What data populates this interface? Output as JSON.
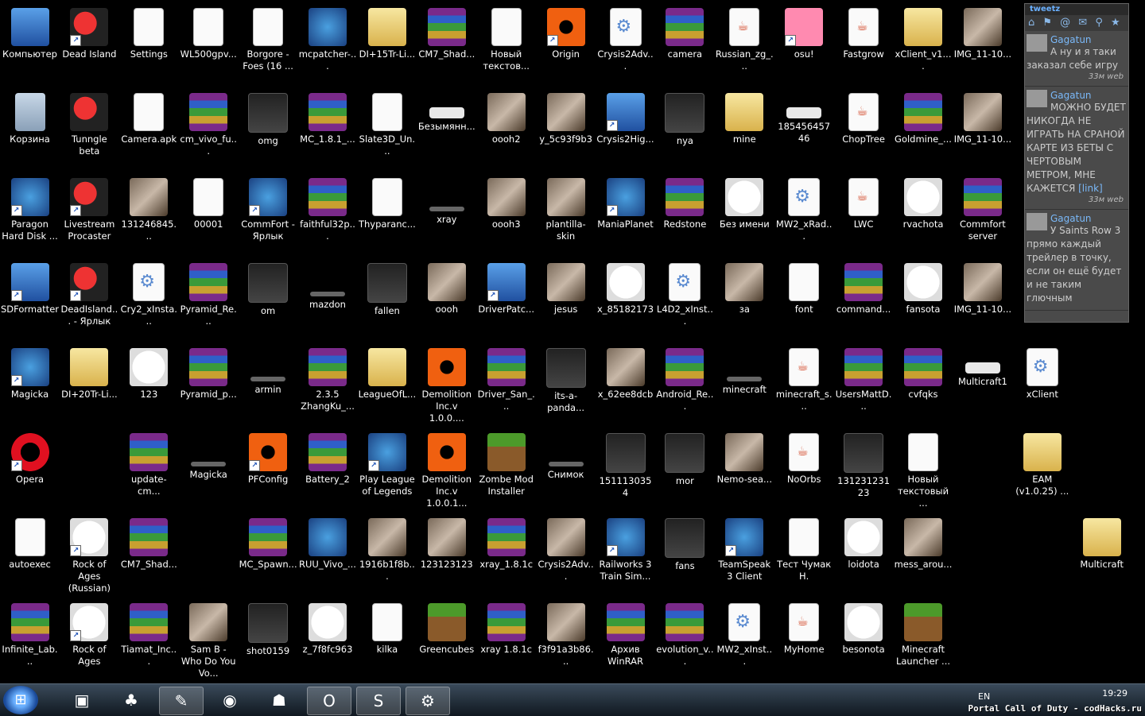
{
  "icons": [
    {
      "label": "Компьютер",
      "type": "pc",
      "col": 0,
      "row": 0,
      "shortcut": false
    },
    {
      "label": "Dead Island",
      "type": "shield",
      "col": 1,
      "row": 0,
      "shortcut": true
    },
    {
      "label": "Settings",
      "type": "doc",
      "col": 2,
      "row": 0,
      "shortcut": false
    },
    {
      "label": "WL500gpv...",
      "type": "doc",
      "col": 3,
      "row": 0,
      "shortcut": false
    },
    {
      "label": "Borgore - Foes (16 ...",
      "type": "doc",
      "col": 4,
      "row": 0,
      "shortcut": false
    },
    {
      "label": "mcpatcher-...",
      "type": "app",
      "col": 5,
      "row": 0,
      "shortcut": false
    },
    {
      "label": "DI+15Tr-Li...",
      "type": "folder",
      "col": 6,
      "row": 0,
      "shortcut": false
    },
    {
      "label": "CM7_Shad...",
      "type": "winrar",
      "col": 7,
      "row": 0,
      "shortcut": false
    },
    {
      "label": "Новый текстов...",
      "type": "doc",
      "col": 8,
      "row": 0,
      "shortcut": false
    },
    {
      "label": "Origin",
      "type": "orange",
      "col": 9,
      "row": 0,
      "shortcut": true
    },
    {
      "label": "Crysis2Adv...",
      "type": "gear",
      "col": 10,
      "row": 0,
      "shortcut": false
    },
    {
      "label": "camera",
      "type": "winrar",
      "col": 11,
      "row": 0,
      "shortcut": false
    },
    {
      "label": "Russian_zg_...",
      "type": "java",
      "col": 12,
      "row": 0,
      "shortcut": false
    },
    {
      "label": "osu!",
      "type": "pink",
      "col": 13,
      "row": 0,
      "shortcut": true
    },
    {
      "label": "Fastgrow",
      "type": "java",
      "col": 14,
      "row": 0,
      "shortcut": false
    },
    {
      "label": "xClient_v1....",
      "type": "folder",
      "col": 15,
      "row": 0,
      "shortcut": false
    },
    {
      "label": "IMG_11-10...",
      "type": "img",
      "col": 16,
      "row": 0,
      "shortcut": false
    },
    {
      "label": "Корзина",
      "type": "bin",
      "col": 0,
      "row": 1,
      "shortcut": false
    },
    {
      "label": "Tunngle beta",
      "type": "shield",
      "col": 1,
      "row": 1,
      "shortcut": false
    },
    {
      "label": "Camera.apk",
      "type": "doc",
      "col": 2,
      "row": 1,
      "shortcut": false
    },
    {
      "label": "cm_vivo_fu...",
      "type": "winrar",
      "col": 3,
      "row": 1,
      "shortcut": false
    },
    {
      "label": "omg",
      "type": "dark",
      "col": 4,
      "row": 1,
      "shortcut": false
    },
    {
      "label": "MC_1.8.1_...",
      "type": "winrar",
      "col": 5,
      "row": 1,
      "shortcut": false
    },
    {
      "label": "Slate3D_Un...",
      "type": "doc",
      "col": 6,
      "row": 1,
      "shortcut": false
    },
    {
      "label": "Безымянн...",
      "type": "wide",
      "col": 7,
      "row": 1,
      "shortcut": false
    },
    {
      "label": "oooh2",
      "type": "img",
      "col": 8,
      "row": 1,
      "shortcut": false
    },
    {
      "label": "y_5c93f9b3",
      "type": "img",
      "col": 9,
      "row": 1,
      "shortcut": false
    },
    {
      "label": "Crysis2Hig...",
      "type": "pc",
      "col": 10,
      "row": 1,
      "shortcut": true
    },
    {
      "label": "nya",
      "type": "dark",
      "col": 11,
      "row": 1,
      "shortcut": false
    },
    {
      "label": "mine",
      "type": "folder",
      "col": 12,
      "row": 1,
      "shortcut": false
    },
    {
      "label": "18545645746",
      "type": "wide",
      "col": 13,
      "row": 1,
      "shortcut": false
    },
    {
      "label": "ChopTree",
      "type": "java",
      "col": 14,
      "row": 1,
      "shortcut": false
    },
    {
      "label": "Goldmine_...",
      "type": "winrar",
      "col": 15,
      "row": 1,
      "shortcut": false
    },
    {
      "label": "IMG_11-10...",
      "type": "img",
      "col": 16,
      "row": 1,
      "shortcut": false
    },
    {
      "label": "Paragon Hard Disk ...",
      "type": "app",
      "col": 0,
      "row": 2,
      "shortcut": true
    },
    {
      "label": "Livestream Procaster",
      "type": "shield",
      "col": 1,
      "row": 2,
      "shortcut": true
    },
    {
      "label": "131246845...",
      "type": "img",
      "col": 2,
      "row": 2,
      "shortcut": false
    },
    {
      "label": "00001",
      "type": "doc",
      "col": 3,
      "row": 2,
      "shortcut": false
    },
    {
      "label": "CommFort - Ярлык",
      "type": "app",
      "col": 4,
      "row": 2,
      "shortcut": true
    },
    {
      "label": "faithful32p...",
      "type": "winrar",
      "col": 5,
      "row": 2,
      "shortcut": false
    },
    {
      "label": "Thyparanc...",
      "type": "doc",
      "col": 6,
      "row": 2,
      "shortcut": false
    },
    {
      "label": "xray",
      "type": "thin",
      "col": 7,
      "row": 2,
      "shortcut": false
    },
    {
      "label": "oooh3",
      "type": "img",
      "col": 8,
      "row": 2,
      "shortcut": false
    },
    {
      "label": "plantilla-skin",
      "type": "img",
      "col": 9,
      "row": 2,
      "shortcut": false
    },
    {
      "label": "ManiaPlanet",
      "type": "app",
      "col": 10,
      "row": 2,
      "shortcut": true
    },
    {
      "label": "Redstone",
      "type": "winrar",
      "col": 11,
      "row": 2,
      "shortcut": false
    },
    {
      "label": "Без имени",
      "type": "face",
      "col": 12,
      "row": 2,
      "shortcut": false
    },
    {
      "label": "MW2_xRad...",
      "type": "gear",
      "col": 13,
      "row": 2,
      "shortcut": false
    },
    {
      "label": "LWC",
      "type": "java",
      "col": 14,
      "row": 2,
      "shortcut": false
    },
    {
      "label": "rvachota",
      "type": "face",
      "col": 15,
      "row": 2,
      "shortcut": false
    },
    {
      "label": "Commfort server",
      "type": "winrar",
      "col": 16,
      "row": 2,
      "shortcut": false
    },
    {
      "label": "SDFormatter",
      "type": "pc",
      "col": 0,
      "row": 3,
      "shortcut": true
    },
    {
      "label": "DeadIsland... - Ярлык",
      "type": "shield",
      "col": 1,
      "row": 3,
      "shortcut": true
    },
    {
      "label": "Cry2_xInsta...",
      "type": "gear",
      "col": 2,
      "row": 3,
      "shortcut": false
    },
    {
      "label": "Pyramid_Re...",
      "type": "winrar",
      "col": 3,
      "row": 3,
      "shortcut": false
    },
    {
      "label": "om",
      "type": "dark",
      "col": 4,
      "row": 3,
      "shortcut": false
    },
    {
      "label": "mazdon",
      "type": "thin",
      "col": 5,
      "row": 3,
      "shortcut": false
    },
    {
      "label": "fallen",
      "type": "dark",
      "col": 6,
      "row": 3,
      "shortcut": false
    },
    {
      "label": "oooh",
      "type": "img",
      "col": 7,
      "row": 3,
      "shortcut": false
    },
    {
      "label": "DriverPatc...",
      "type": "pc",
      "col": 8,
      "row": 3,
      "shortcut": true
    },
    {
      "label": "jesus",
      "type": "img",
      "col": 9,
      "row": 3,
      "shortcut": false
    },
    {
      "label": "x_85182173",
      "type": "face",
      "col": 10,
      "row": 3,
      "shortcut": false
    },
    {
      "label": "L4D2_xInst...",
      "type": "gear",
      "col": 11,
      "row": 3,
      "shortcut": false
    },
    {
      "label": "за",
      "type": "img",
      "col": 12,
      "row": 3,
      "shortcut": false
    },
    {
      "label": "font",
      "type": "doc",
      "col": 13,
      "row": 3,
      "shortcut": false
    },
    {
      "label": "command...",
      "type": "winrar",
      "col": 14,
      "row": 3,
      "shortcut": false
    },
    {
      "label": "fansota",
      "type": "face",
      "col": 15,
      "row": 3,
      "shortcut": false
    },
    {
      "label": "IMG_11-10...",
      "type": "img",
      "col": 16,
      "row": 3,
      "shortcut": false
    },
    {
      "label": "Magicka",
      "type": "app",
      "col": 0,
      "row": 4,
      "shortcut": true
    },
    {
      "label": "DI+20Tr-Li...",
      "type": "folder",
      "col": 1,
      "row": 4,
      "shortcut": false
    },
    {
      "label": "123",
      "type": "face",
      "col": 2,
      "row": 4,
      "shortcut": false
    },
    {
      "label": "Pyramid_p...",
      "type": "winrar",
      "col": 3,
      "row": 4,
      "shortcut": false
    },
    {
      "label": "armin",
      "type": "thin",
      "col": 4,
      "row": 4,
      "shortcut": false
    },
    {
      "label": "2.3.5 ZhangKu_...",
      "type": "winrar",
      "col": 5,
      "row": 4,
      "shortcut": false
    },
    {
      "label": "LeagueOfL...",
      "type": "folder",
      "col": 6,
      "row": 4,
      "shortcut": false
    },
    {
      "label": "Demolition Inc.v 1.0.0....",
      "type": "orange",
      "col": 7,
      "row": 4,
      "shortcut": false
    },
    {
      "label": "Driver_San_...",
      "type": "winrar",
      "col": 8,
      "row": 4,
      "shortcut": false
    },
    {
      "label": "its-a-panda...",
      "type": "dark",
      "col": 9,
      "row": 4,
      "shortcut": false
    },
    {
      "label": "x_62ee8dcb",
      "type": "img",
      "col": 10,
      "row": 4,
      "shortcut": false
    },
    {
      "label": "Android_Re...",
      "type": "winrar",
      "col": 11,
      "row": 4,
      "shortcut": false
    },
    {
      "label": "minecraft",
      "type": "thin",
      "col": 12,
      "row": 4,
      "shortcut": false
    },
    {
      "label": "minecraft_s...",
      "type": "java",
      "col": 13,
      "row": 4,
      "shortcut": false
    },
    {
      "label": "UsersMattD...",
      "type": "winrar",
      "col": 14,
      "row": 4,
      "shortcut": false
    },
    {
      "label": "cvfqks",
      "type": "winrar",
      "col": 15,
      "row": 4,
      "shortcut": false
    },
    {
      "label": "Multicraft1",
      "type": "wide",
      "col": 16,
      "row": 4,
      "shortcut": false
    },
    {
      "label": "xClient",
      "type": "gear",
      "col": 17,
      "row": 4,
      "shortcut": false
    },
    {
      "label": "Opera",
      "type": "opera",
      "col": 0,
      "row": 5,
      "shortcut": true
    },
    {
      "label": "update-cm...",
      "type": "winrar",
      "col": 2,
      "row": 5,
      "shortcut": false
    },
    {
      "label": "Magicka",
      "type": "thin",
      "col": 3,
      "row": 5,
      "shortcut": false
    },
    {
      "label": "PFConfig",
      "type": "orange",
      "col": 4,
      "row": 5,
      "shortcut": true
    },
    {
      "label": "Battery_2",
      "type": "winrar",
      "col": 5,
      "row": 5,
      "shortcut": false
    },
    {
      "label": "Play League of Legends",
      "type": "app",
      "col": 6,
      "row": 5,
      "shortcut": true
    },
    {
      "label": "Demolition Inc.v 1.0.0.1...",
      "type": "orange",
      "col": 7,
      "row": 5,
      "shortcut": false
    },
    {
      "label": "Zombe Mod Installer",
      "type": "minecraft",
      "col": 8,
      "row": 5,
      "shortcut": false
    },
    {
      "label": "Снимок",
      "type": "thin",
      "col": 9,
      "row": 5,
      "shortcut": false
    },
    {
      "label": "1511130354",
      "type": "dark",
      "col": 10,
      "row": 5,
      "shortcut": false
    },
    {
      "label": "mor",
      "type": "dark",
      "col": 11,
      "row": 5,
      "shortcut": false
    },
    {
      "label": "Nemo-sea...",
      "type": "img",
      "col": 12,
      "row": 5,
      "shortcut": false
    },
    {
      "label": "NoOrbs",
      "type": "java",
      "col": 13,
      "row": 5,
      "shortcut": false
    },
    {
      "label": "13123123123",
      "type": "dark",
      "col": 14,
      "row": 5,
      "shortcut": false
    },
    {
      "label": "Новый текстовый ...",
      "type": "doc",
      "col": 15,
      "row": 5,
      "shortcut": false
    },
    {
      "label": "EAM (v1.0.25) ...",
      "type": "folder",
      "col": 17,
      "row": 5,
      "shortcut": false
    },
    {
      "label": "autoexec",
      "type": "doc",
      "col": 0,
      "row": 6,
      "shortcut": false
    },
    {
      "label": "Rock of Ages (Russian)",
      "type": "face",
      "col": 1,
      "row": 6,
      "shortcut": true
    },
    {
      "label": "CM7_Shad...",
      "type": "winrar",
      "col": 2,
      "row": 6,
      "shortcut": false
    },
    {
      "label": "MC_Spawn...",
      "type": "winrar",
      "col": 4,
      "row": 6,
      "shortcut": false
    },
    {
      "label": "RUU_Vivo_...",
      "type": "app",
      "col": 5,
      "row": 6,
      "shortcut": false
    },
    {
      "label": "1916b1f8b...",
      "type": "img",
      "col": 6,
      "row": 6,
      "shortcut": false
    },
    {
      "label": "123123123",
      "type": "img",
      "col": 7,
      "row": 6,
      "shortcut": false
    },
    {
      "label": "xray_1.8.1c",
      "type": "winrar",
      "col": 8,
      "row": 6,
      "shortcut": false
    },
    {
      "label": "Crysis2Adv...",
      "type": "img",
      "col": 9,
      "row": 6,
      "shortcut": false
    },
    {
      "label": "Railworks 3 Train Sim...",
      "type": "app",
      "col": 10,
      "row": 6,
      "shortcut": true
    },
    {
      "label": "fans",
      "type": "dark",
      "col": 11,
      "row": 6,
      "shortcut": false
    },
    {
      "label": "TeamSpeak 3 Client",
      "type": "app",
      "col": 12,
      "row": 6,
      "shortcut": true
    },
    {
      "label": "Тест Чумак Н.",
      "type": "doc",
      "col": 13,
      "row": 6,
      "shortcut": false
    },
    {
      "label": "loidota",
      "type": "face",
      "col": 14,
      "row": 6,
      "shortcut": false
    },
    {
      "label": "mess_arou...",
      "type": "img",
      "col": 15,
      "row": 6,
      "shortcut": false
    },
    {
      "label": "Multicraft",
      "type": "folder",
      "col": 18,
      "row": 6,
      "shortcut": false
    },
    {
      "label": "Infinite_Lab...",
      "type": "winrar",
      "col": 0,
      "row": 7,
      "shortcut": false
    },
    {
      "label": "Rock of Ages",
      "type": "face",
      "col": 1,
      "row": 7,
      "shortcut": true
    },
    {
      "label": "Tiamat_Inc...",
      "type": "winrar",
      "col": 2,
      "row": 7,
      "shortcut": false
    },
    {
      "label": "Sam B - Who Do You Vo...",
      "type": "img",
      "col": 3,
      "row": 7,
      "shortcut": false
    },
    {
      "label": "shot0159",
      "type": "dark",
      "col": 4,
      "row": 7,
      "shortcut": false
    },
    {
      "label": "z_7f8fc963",
      "type": "face",
      "col": 5,
      "row": 7,
      "shortcut": false
    },
    {
      "label": "kilka",
      "type": "doc",
      "col": 6,
      "row": 7,
      "shortcut": false
    },
    {
      "label": "Greencubes",
      "type": "minecraft",
      "col": 7,
      "row": 7,
      "shortcut": false
    },
    {
      "label": "xray 1.8.1c",
      "type": "winrar",
      "col": 8,
      "row": 7,
      "shortcut": false
    },
    {
      "label": "f3f91a3b86...",
      "type": "img",
      "col": 9,
      "row": 7,
      "shortcut": false
    },
    {
      "label": "Архив WinRAR",
      "type": "winrar",
      "col": 10,
      "row": 7,
      "shortcut": false
    },
    {
      "label": "evolution_v...",
      "type": "winrar",
      "col": 11,
      "row": 7,
      "shortcut": false
    },
    {
      "label": "MW2_xInst...",
      "type": "gear",
      "col": 12,
      "row": 7,
      "shortcut": false
    },
    {
      "label": "MyHome",
      "type": "java",
      "col": 13,
      "row": 7,
      "shortcut": false
    },
    {
      "label": "besonota",
      "type": "face",
      "col": 14,
      "row": 7,
      "shortcut": false
    },
    {
      "label": "Minecraft Launcher ...",
      "type": "minecraft",
      "col": 15,
      "row": 7,
      "shortcut": false
    }
  ],
  "tweetz": {
    "title": "tweetz",
    "tools": "⌂ ⚑ @ ✉ ⚲ ★",
    "tweets": [
      {
        "user": "Gagatun",
        "text": "А ну и я таки заказал себе игру",
        "time": "33м web"
      },
      {
        "user": "Gagatun",
        "text": "МОЖНО БУДЕТ НИКОГДА НЕ ИГРАТЬ НА СРАНОЙ КАРТЕ ИЗ БЕТЫ С ЧЕРТОВЫМ МЕТРОМ, МНЕ КАЖЕТСЯ",
        "link": "[link]",
        "time": "33м web"
      },
      {
        "user": "Gagatun",
        "text": "У Saints Row 3 прямо каждый трейлер в точку, если он ещё будет и не таким глючным",
        "time": ""
      }
    ]
  },
  "taskbar": {
    "start_glyph": "⊞",
    "items": [
      {
        "name": "taskbar-minecraft",
        "glyph": "▣",
        "active": false
      },
      {
        "name": "taskbar-app-green",
        "glyph": "♣",
        "active": false
      },
      {
        "name": "taskbar-commfort",
        "glyph": "✎",
        "active": true
      },
      {
        "name": "taskbar-globe",
        "glyph": "◉",
        "active": false
      },
      {
        "name": "taskbar-game",
        "glyph": "☗",
        "active": false
      },
      {
        "name": "taskbar-opera",
        "glyph": "O",
        "active": true
      },
      {
        "name": "taskbar-skype",
        "glyph": "S",
        "active": true
      },
      {
        "name": "taskbar-steam",
        "glyph": "⚙",
        "active": true
      }
    ],
    "lang": "EN",
    "clock": "19:29"
  },
  "watermark": "Portal Call of Duty - codHacks.ru"
}
